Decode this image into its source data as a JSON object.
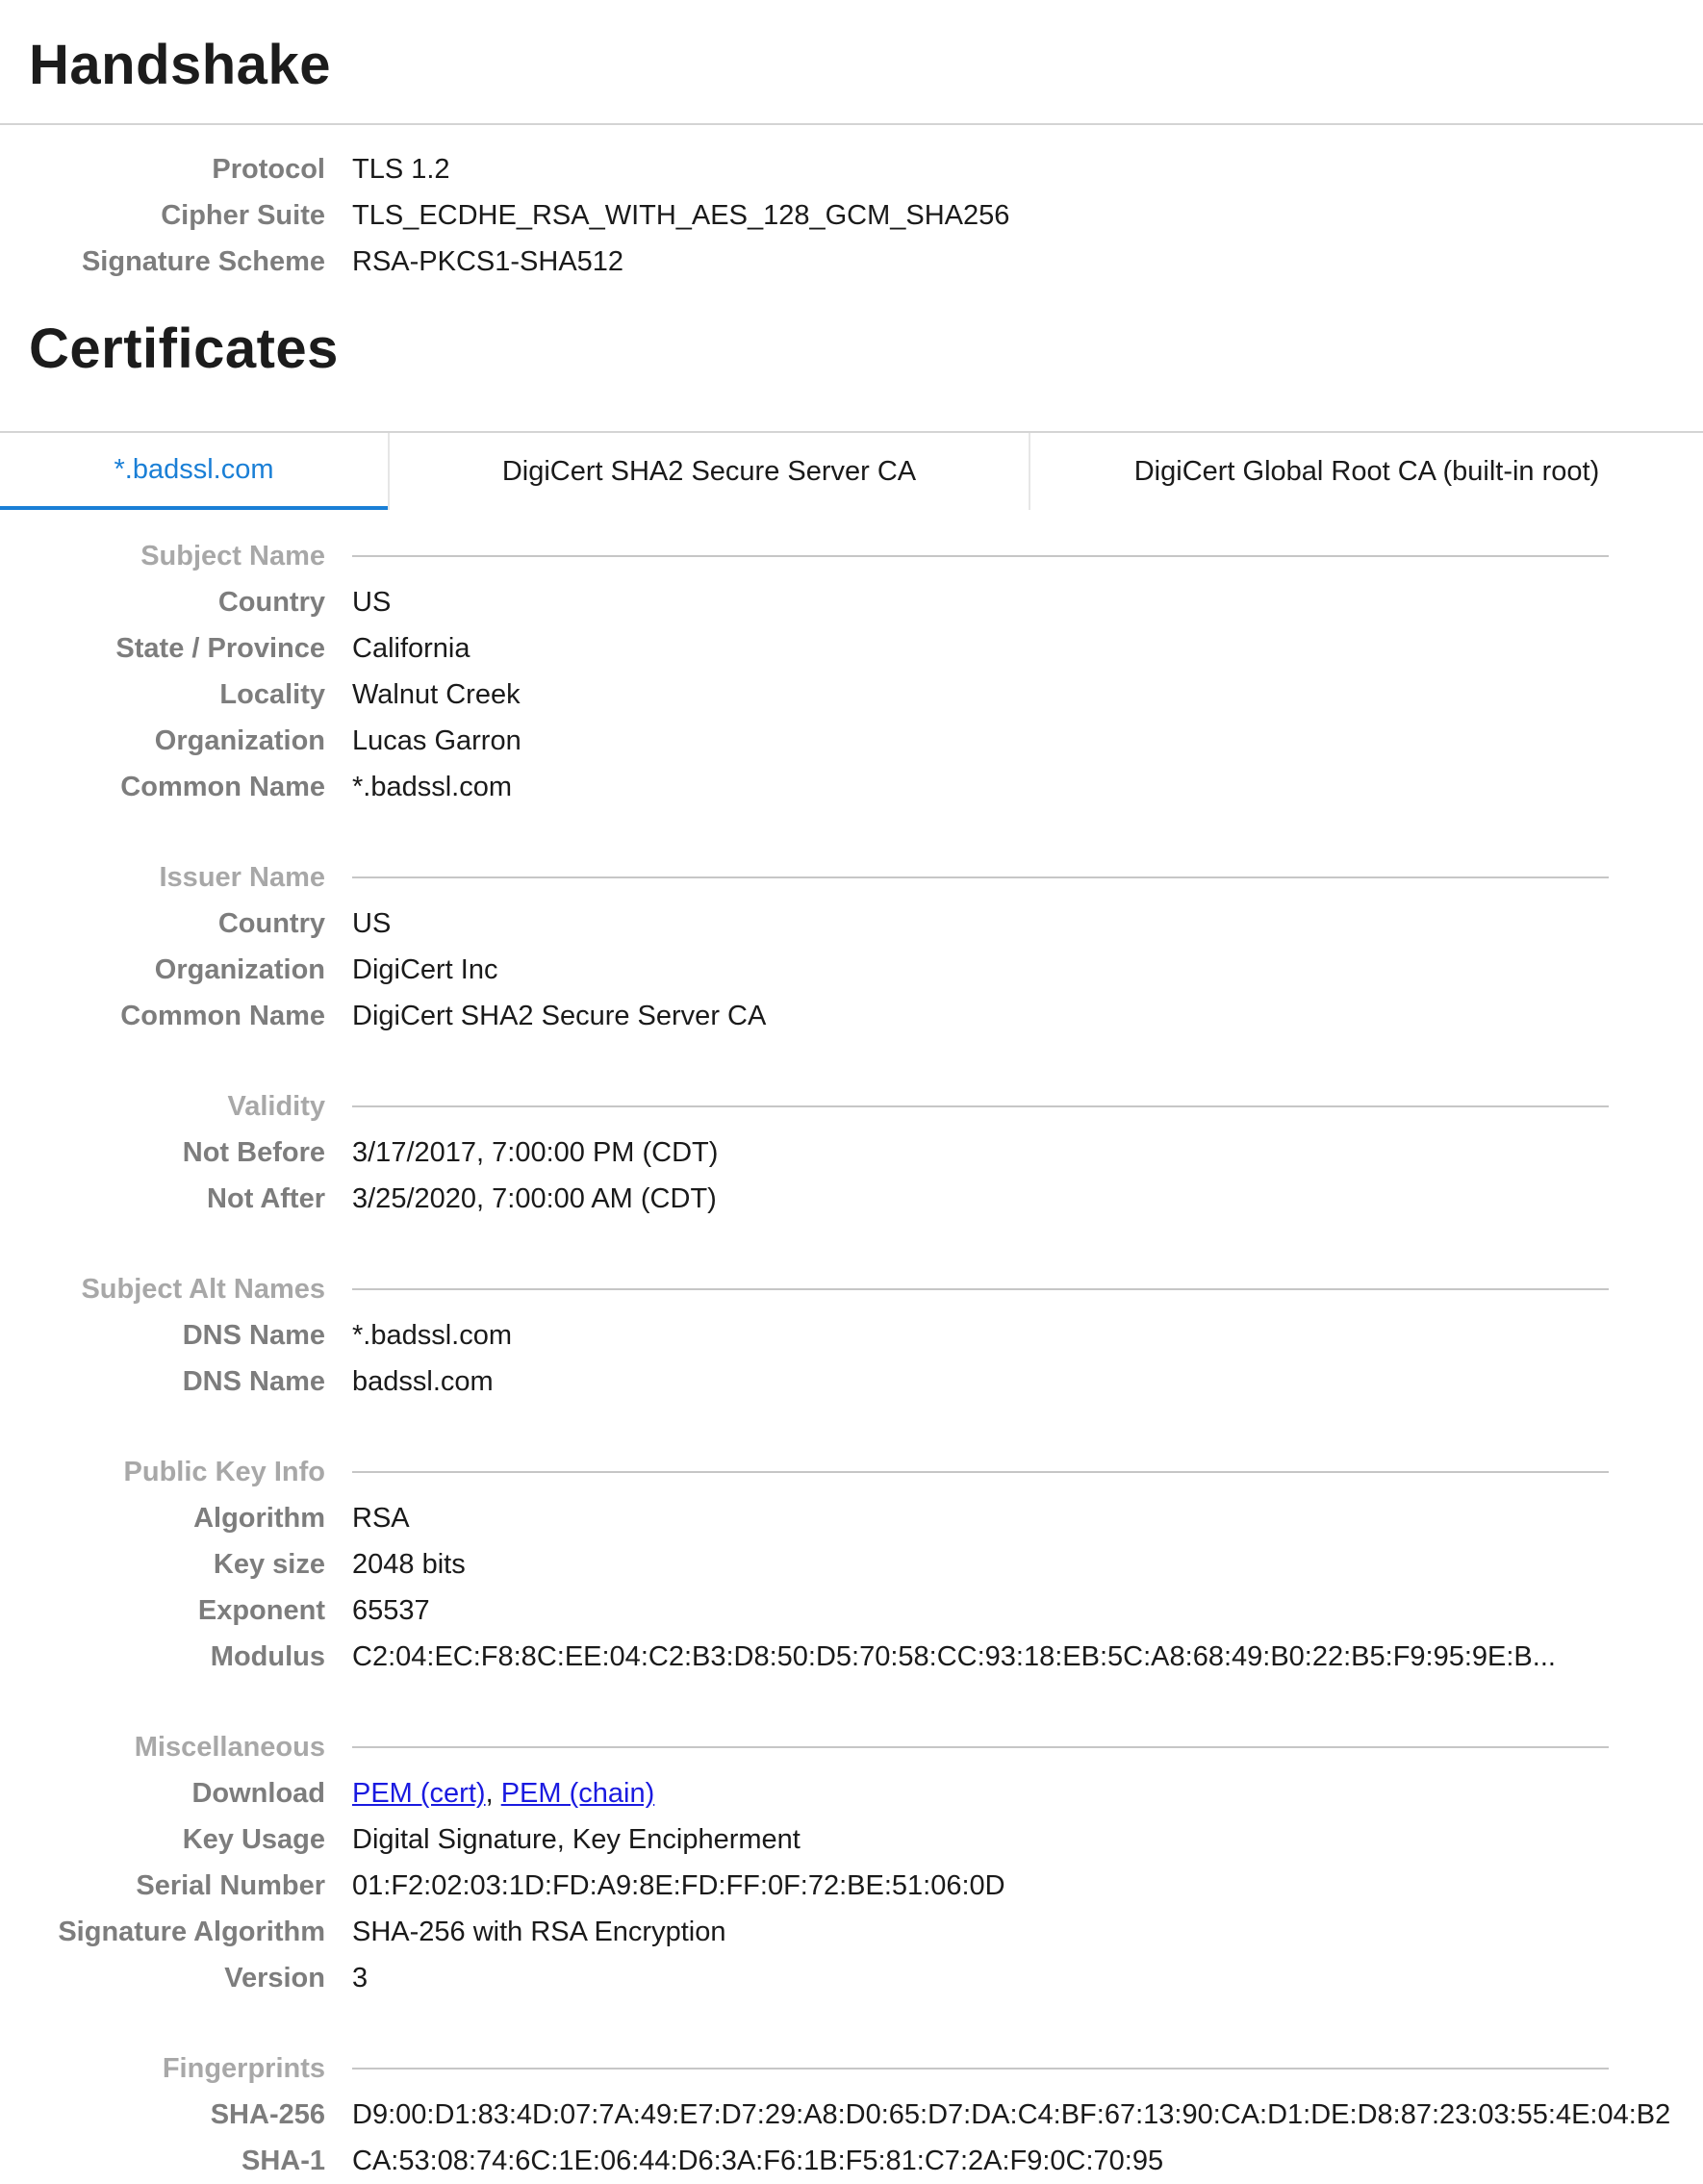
{
  "handshake": {
    "title": "Handshake",
    "rows": [
      {
        "label": "Protocol",
        "value": "TLS 1.2"
      },
      {
        "label": "Cipher Suite",
        "value": "TLS_ECDHE_RSA_WITH_AES_128_GCM_SHA256"
      },
      {
        "label": "Signature Scheme",
        "value": "RSA-PKCS1-SHA512"
      }
    ]
  },
  "certificates": {
    "title": "Certificates",
    "tabs": [
      {
        "label": "*.badssl.com",
        "active": true
      },
      {
        "label": "DigiCert SHA2 Secure Server CA",
        "active": false
      },
      {
        "label": "DigiCert Global Root CA (built-in root)",
        "active": false
      }
    ],
    "groups": [
      {
        "name": "Subject Name",
        "rows": [
          {
            "label": "Country",
            "value": "US"
          },
          {
            "label": "State / Province",
            "value": "California"
          },
          {
            "label": "Locality",
            "value": "Walnut Creek"
          },
          {
            "label": "Organization",
            "value": "Lucas Garron"
          },
          {
            "label": "Common Name",
            "value": "*.badssl.com"
          }
        ]
      },
      {
        "name": "Issuer Name",
        "rows": [
          {
            "label": "Country",
            "value": "US"
          },
          {
            "label": "Organization",
            "value": "DigiCert Inc"
          },
          {
            "label": "Common Name",
            "value": "DigiCert SHA2 Secure Server CA"
          }
        ]
      },
      {
        "name": "Validity",
        "rows": [
          {
            "label": "Not Before",
            "value": "3/17/2017, 7:00:00 PM (CDT)"
          },
          {
            "label": "Not After",
            "value": "3/25/2020, 7:00:00 AM (CDT)"
          }
        ]
      },
      {
        "name": "Subject Alt Names",
        "rows": [
          {
            "label": "DNS Name",
            "value": "*.badssl.com"
          },
          {
            "label": "DNS Name",
            "value": "badssl.com"
          }
        ]
      },
      {
        "name": "Public Key Info",
        "rows": [
          {
            "label": "Algorithm",
            "value": "RSA"
          },
          {
            "label": "Key size",
            "value": "2048 bits"
          },
          {
            "label": "Exponent",
            "value": "65537"
          },
          {
            "label": "Modulus",
            "value": "C2:04:EC:F8:8C:EE:04:C2:B3:D8:50:D5:70:58:CC:93:18:EB:5C:A8:68:49:B0:22:B5:F9:95:9E:B..."
          }
        ]
      },
      {
        "name": "Miscellaneous",
        "rows": [
          {
            "label": "Download",
            "links": [
              "PEM (cert)",
              "PEM (chain)"
            ],
            "separator": ", "
          },
          {
            "label": "Key Usage",
            "value": "Digital Signature, Key Encipherment"
          },
          {
            "label": "Serial Number",
            "value": "01:F2:02:03:1D:FD:A9:8E:FD:FF:0F:72:BE:51:06:0D"
          },
          {
            "label": "Signature Algorithm",
            "value": "SHA-256 with RSA Encryption"
          },
          {
            "label": "Version",
            "value": "3"
          }
        ]
      },
      {
        "name": "Fingerprints",
        "rows": [
          {
            "label": "SHA-256",
            "value": "D9:00:D1:83:4D:07:7A:49:E7:D7:29:A8:D0:65:D7:DA:C4:BF:67:13:90:CA:D1:DE:D8:87:23:03:55:4E:04:B2"
          },
          {
            "label": "SHA-1",
            "value": "CA:53:08:74:6C:1E:06:44:D6:3A:F6:1B:F5:81:C7:2A:F9:0C:70:95"
          }
        ]
      }
    ]
  },
  "colors": {
    "accent": "#1a7fd6",
    "link": "#1a1ae0",
    "label": "#7d7d7d",
    "group_label": "#a8a8a8"
  }
}
